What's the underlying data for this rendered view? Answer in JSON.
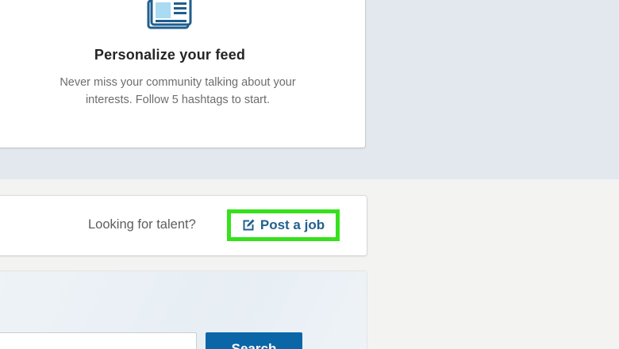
{
  "feed_card": {
    "icon": "newspaper-icon",
    "title": "Personalize your feed",
    "description_line1": "Never miss your community talking about your",
    "description_line2": "interests. Follow 5 hashtags to start."
  },
  "talent_card": {
    "prompt": "Looking for talent?",
    "post_job_label": "Post a job",
    "post_job_icon": "edit-icon",
    "highlight_color": "#36e11c"
  },
  "search_card": {
    "input_value": "",
    "button_label": "Search",
    "button_color": "#0b66a8"
  },
  "colors": {
    "link_blue": "#22618f",
    "icon_blue": "#1f5e8e",
    "icon_fill": "#a9dbf3"
  }
}
